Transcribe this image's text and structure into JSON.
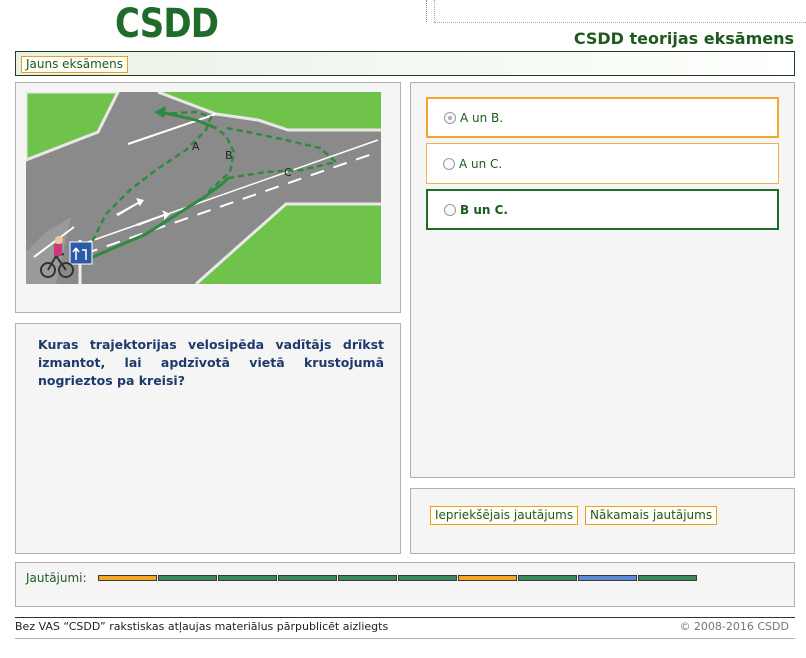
{
  "header": {
    "logo_text": "CSDD",
    "app_title": "CSDD teorijas eksāmens"
  },
  "toolbar": {
    "new_exam_label": "Jauns eksāmens"
  },
  "scene": {
    "path_labels": [
      "A",
      "B",
      "C"
    ]
  },
  "question": {
    "text": "Kuras trajektorijas velosipēda vadītājs drīkst izmantot, lai apdzīvotā vietā krustojumā nogrieztos pa kreisi?"
  },
  "answers": [
    {
      "label": "A un B.",
      "selected": true
    },
    {
      "label": "A un C.",
      "selected": false
    },
    {
      "label": "B un C.",
      "selected": false
    }
  ],
  "navigation": {
    "prev_label": "Iepriekšējais jautājums",
    "next_label": "Nākamais jautājums"
  },
  "progress": {
    "label": "Jautājumi:",
    "segments": [
      "warn",
      "done",
      "done",
      "done",
      "done",
      "done",
      "warn",
      "done",
      "current",
      "done"
    ]
  },
  "footer": {
    "left_text": "Bez VAS “CSDD” rakstiskas atļaujas materiālus pārpublicēt aizliegts",
    "right_text": "© 2008-2016 CSDD"
  },
  "colors": {
    "brand_green": "#1e6b2c",
    "accent_orange": "#f0a830",
    "question_blue": "#1f3a6a"
  }
}
